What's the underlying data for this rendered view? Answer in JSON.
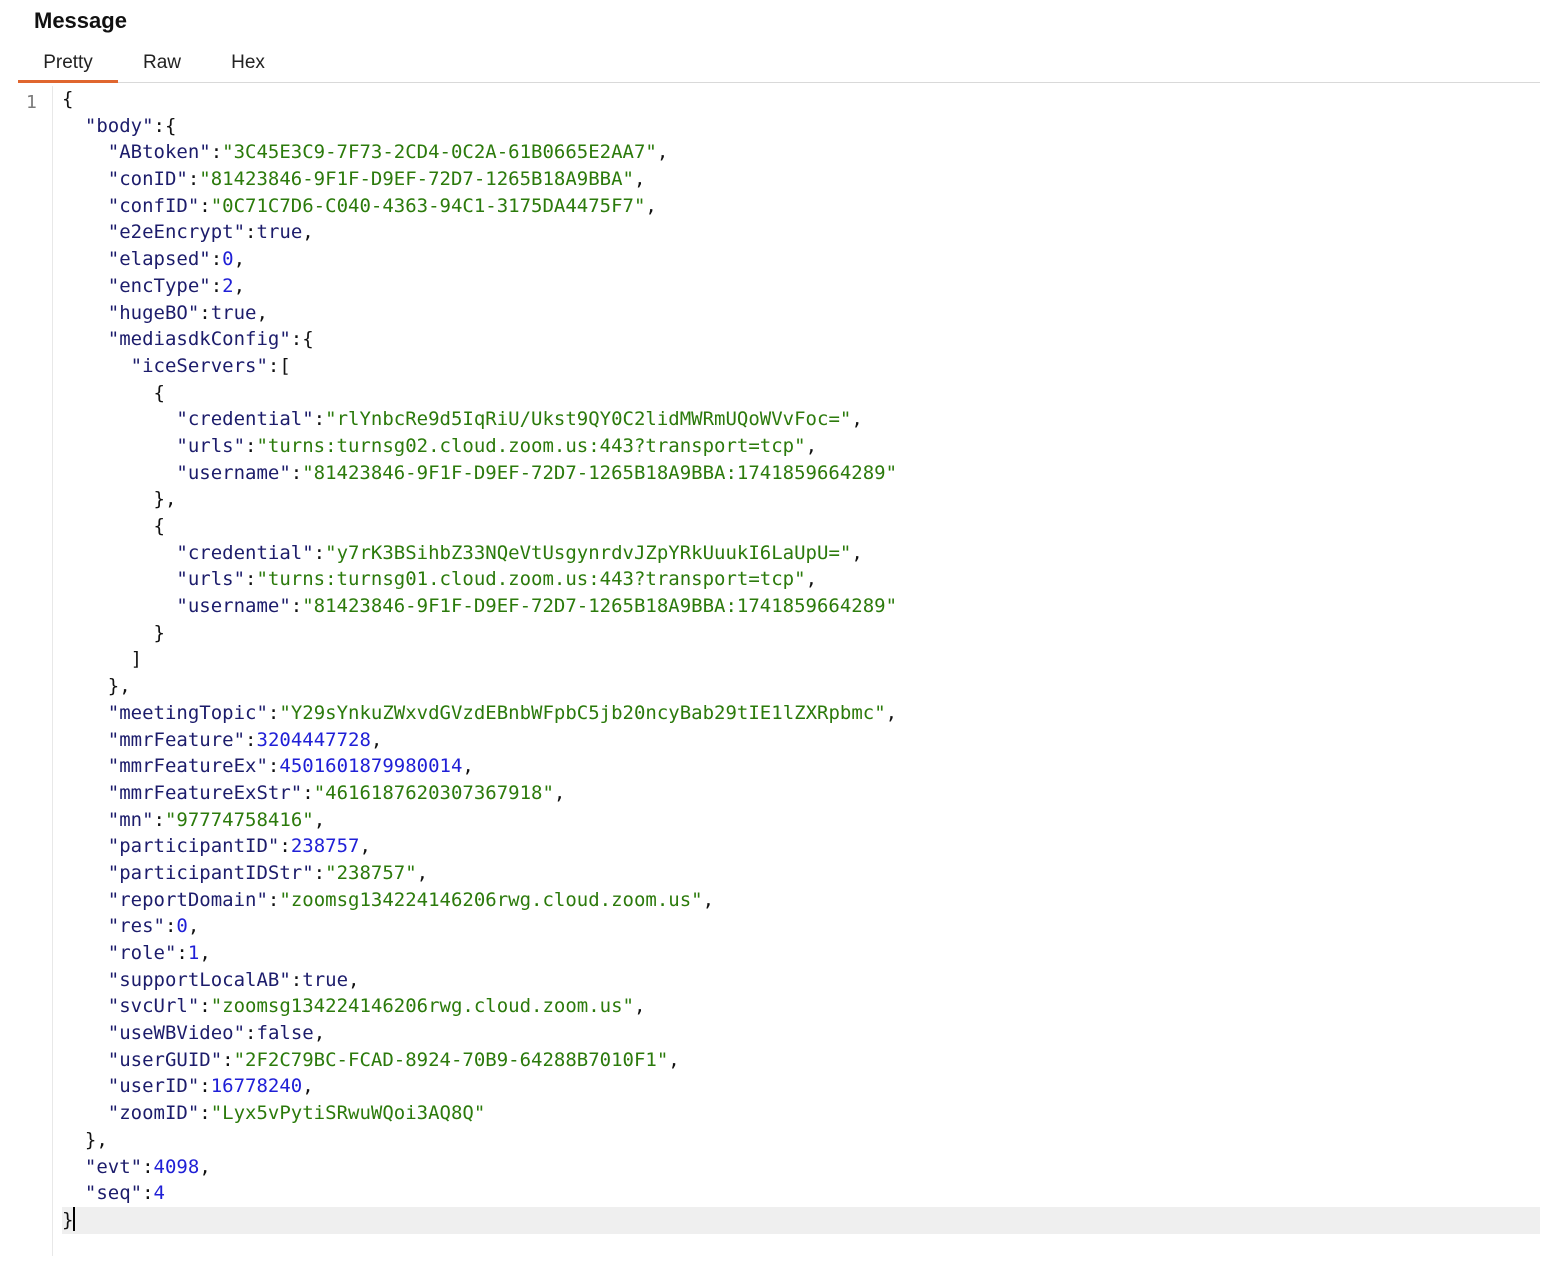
{
  "header": {
    "title": "Message"
  },
  "tabs": [
    {
      "label": "Pretty",
      "active": true
    },
    {
      "label": "Raw",
      "active": false
    },
    {
      "label": "Hex",
      "active": false
    }
  ],
  "editor": {
    "line_number": "1",
    "lines": [
      [
        [
          "p",
          "{"
        ]
      ],
      [
        [
          "p",
          "  "
        ],
        [
          "k",
          "\"body\""
        ],
        [
          "p",
          ":{"
        ]
      ],
      [
        [
          "p",
          "    "
        ],
        [
          "k",
          "\"ABtoken\""
        ],
        [
          "p",
          ":"
        ],
        [
          "s",
          "\"3C45E3C9-7F73-2CD4-0C2A-61B0665E2AA7\""
        ],
        [
          "p",
          ","
        ]
      ],
      [
        [
          "p",
          "    "
        ],
        [
          "k",
          "\"conID\""
        ],
        [
          "p",
          ":"
        ],
        [
          "s",
          "\"81423846-9F1F-D9EF-72D7-1265B18A9BBA\""
        ],
        [
          "p",
          ","
        ]
      ],
      [
        [
          "p",
          "    "
        ],
        [
          "k",
          "\"confID\""
        ],
        [
          "p",
          ":"
        ],
        [
          "s",
          "\"0C71C7D6-C040-4363-94C1-3175DA4475F7\""
        ],
        [
          "p",
          ","
        ]
      ],
      [
        [
          "p",
          "    "
        ],
        [
          "k",
          "\"e2eEncrypt\""
        ],
        [
          "p",
          ":"
        ],
        [
          "b",
          "true"
        ],
        [
          "p",
          ","
        ]
      ],
      [
        [
          "p",
          "    "
        ],
        [
          "k",
          "\"elapsed\""
        ],
        [
          "p",
          ":"
        ],
        [
          "n",
          "0"
        ],
        [
          "p",
          ","
        ]
      ],
      [
        [
          "p",
          "    "
        ],
        [
          "k",
          "\"encType\""
        ],
        [
          "p",
          ":"
        ],
        [
          "n",
          "2"
        ],
        [
          "p",
          ","
        ]
      ],
      [
        [
          "p",
          "    "
        ],
        [
          "k",
          "\"hugeBO\""
        ],
        [
          "p",
          ":"
        ],
        [
          "b",
          "true"
        ],
        [
          "p",
          ","
        ]
      ],
      [
        [
          "p",
          "    "
        ],
        [
          "k",
          "\"mediasdkConfig\""
        ],
        [
          "p",
          ":{"
        ]
      ],
      [
        [
          "p",
          "      "
        ],
        [
          "k",
          "\"iceServers\""
        ],
        [
          "p",
          ":["
        ]
      ],
      [
        [
          "p",
          "        {"
        ]
      ],
      [
        [
          "p",
          "          "
        ],
        [
          "k",
          "\"credential\""
        ],
        [
          "p",
          ":"
        ],
        [
          "s",
          "\"rlYnbcRe9d5IqRiU/Ukst9QY0C2lidMWRmUQoWVvFoc=\""
        ],
        [
          "p",
          ","
        ]
      ],
      [
        [
          "p",
          "          "
        ],
        [
          "k",
          "\"urls\""
        ],
        [
          "p",
          ":"
        ],
        [
          "s",
          "\"turns:turnsg02.cloud.zoom.us:443?transport=tcp\""
        ],
        [
          "p",
          ","
        ]
      ],
      [
        [
          "p",
          "          "
        ],
        [
          "k",
          "\"username\""
        ],
        [
          "p",
          ":"
        ],
        [
          "s",
          "\"81423846-9F1F-D9EF-72D7-1265B18A9BBA:1741859664289\""
        ]
      ],
      [
        [
          "p",
          "        },"
        ]
      ],
      [
        [
          "p",
          "        {"
        ]
      ],
      [
        [
          "p",
          "          "
        ],
        [
          "k",
          "\"credential\""
        ],
        [
          "p",
          ":"
        ],
        [
          "s",
          "\"y7rK3BSihbZ33NQeVtUsgynrdvJZpYRkUuukI6LaUpU=\""
        ],
        [
          "p",
          ","
        ]
      ],
      [
        [
          "p",
          "          "
        ],
        [
          "k",
          "\"urls\""
        ],
        [
          "p",
          ":"
        ],
        [
          "s",
          "\"turns:turnsg01.cloud.zoom.us:443?transport=tcp\""
        ],
        [
          "p",
          ","
        ]
      ],
      [
        [
          "p",
          "          "
        ],
        [
          "k",
          "\"username\""
        ],
        [
          "p",
          ":"
        ],
        [
          "s",
          "\"81423846-9F1F-D9EF-72D7-1265B18A9BBA:1741859664289\""
        ]
      ],
      [
        [
          "p",
          "        }"
        ]
      ],
      [
        [
          "p",
          "      ]"
        ]
      ],
      [
        [
          "p",
          "    },"
        ]
      ],
      [
        [
          "p",
          "    "
        ],
        [
          "k",
          "\"meetingTopic\""
        ],
        [
          "p",
          ":"
        ],
        [
          "s",
          "\"Y29sYnkuZWxvdGVzdEBnbWFpbC5jb20ncyBab29tIE1lZXRpbmc\""
        ],
        [
          "p",
          ","
        ]
      ],
      [
        [
          "p",
          "    "
        ],
        [
          "k",
          "\"mmrFeature\""
        ],
        [
          "p",
          ":"
        ],
        [
          "n",
          "3204447728"
        ],
        [
          "p",
          ","
        ]
      ],
      [
        [
          "p",
          "    "
        ],
        [
          "k",
          "\"mmrFeatureEx\""
        ],
        [
          "p",
          ":"
        ],
        [
          "n",
          "4501601879980014"
        ],
        [
          "p",
          ","
        ]
      ],
      [
        [
          "p",
          "    "
        ],
        [
          "k",
          "\"mmrFeatureExStr\""
        ],
        [
          "p",
          ":"
        ],
        [
          "s",
          "\"4616187620307367918\""
        ],
        [
          "p",
          ","
        ]
      ],
      [
        [
          "p",
          "    "
        ],
        [
          "k",
          "\"mn\""
        ],
        [
          "p",
          ":"
        ],
        [
          "s",
          "\"97774758416\""
        ],
        [
          "p",
          ","
        ]
      ],
      [
        [
          "p",
          "    "
        ],
        [
          "k",
          "\"participantID\""
        ],
        [
          "p",
          ":"
        ],
        [
          "n",
          "238757"
        ],
        [
          "p",
          ","
        ]
      ],
      [
        [
          "p",
          "    "
        ],
        [
          "k",
          "\"participantIDStr\""
        ],
        [
          "p",
          ":"
        ],
        [
          "s",
          "\"238757\""
        ],
        [
          "p",
          ","
        ]
      ],
      [
        [
          "p",
          "    "
        ],
        [
          "k",
          "\"reportDomain\""
        ],
        [
          "p",
          ":"
        ],
        [
          "s",
          "\"zoomsg134224146206rwg.cloud.zoom.us\""
        ],
        [
          "p",
          ","
        ]
      ],
      [
        [
          "p",
          "    "
        ],
        [
          "k",
          "\"res\""
        ],
        [
          "p",
          ":"
        ],
        [
          "n",
          "0"
        ],
        [
          "p",
          ","
        ]
      ],
      [
        [
          "p",
          "    "
        ],
        [
          "k",
          "\"role\""
        ],
        [
          "p",
          ":"
        ],
        [
          "n",
          "1"
        ],
        [
          "p",
          ","
        ]
      ],
      [
        [
          "p",
          "    "
        ],
        [
          "k",
          "\"supportLocalAB\""
        ],
        [
          "p",
          ":"
        ],
        [
          "b",
          "true"
        ],
        [
          "p",
          ","
        ]
      ],
      [
        [
          "p",
          "    "
        ],
        [
          "k",
          "\"svcUrl\""
        ],
        [
          "p",
          ":"
        ],
        [
          "s",
          "\"zoomsg134224146206rwg.cloud.zoom.us\""
        ],
        [
          "p",
          ","
        ]
      ],
      [
        [
          "p",
          "    "
        ],
        [
          "k",
          "\"useWBVideo\""
        ],
        [
          "p",
          ":"
        ],
        [
          "b",
          "false"
        ],
        [
          "p",
          ","
        ]
      ],
      [
        [
          "p",
          "    "
        ],
        [
          "k",
          "\"userGUID\""
        ],
        [
          "p",
          ":"
        ],
        [
          "s",
          "\"2F2C79BC-FCAD-8924-70B9-64288B7010F1\""
        ],
        [
          "p",
          ","
        ]
      ],
      [
        [
          "p",
          "    "
        ],
        [
          "k",
          "\"userID\""
        ],
        [
          "p",
          ":"
        ],
        [
          "n",
          "16778240"
        ],
        [
          "p",
          ","
        ]
      ],
      [
        [
          "p",
          "    "
        ],
        [
          "k",
          "\"zoomID\""
        ],
        [
          "p",
          ":"
        ],
        [
          "s",
          "\"Lyx5vPytiSRwuWQoi3AQ8Q\""
        ]
      ],
      [
        [
          "p",
          "  },"
        ]
      ],
      [
        [
          "p",
          "  "
        ],
        [
          "k",
          "\"evt\""
        ],
        [
          "p",
          ":"
        ],
        [
          "n",
          "4098"
        ],
        [
          "p",
          ","
        ]
      ],
      [
        [
          "p",
          "  "
        ],
        [
          "k",
          "\"seq\""
        ],
        [
          "p",
          ":"
        ],
        [
          "n",
          "4"
        ]
      ],
      [
        [
          "p",
          "}"
        ]
      ]
    ]
  }
}
